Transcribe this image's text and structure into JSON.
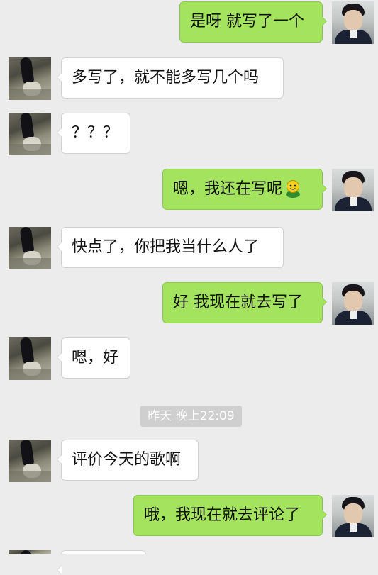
{
  "chat": {
    "messages": [
      {
        "side": "out",
        "text": "是呀 就写了一个"
      },
      {
        "side": "in",
        "text": "多写了，就不能多写几个吗"
      },
      {
        "side": "in",
        "text": "？？？"
      },
      {
        "side": "out",
        "text": "嗯，我还在写呢",
        "emoji": "smiley-emoji-icon"
      },
      {
        "side": "in",
        "text": "快点了，你把我当什么人了"
      },
      {
        "side": "out",
        "text": "好 我现在就去写了"
      },
      {
        "side": "in",
        "text": "嗯，好"
      },
      {
        "side": "in",
        "text": "评价今天的歌啊"
      },
      {
        "side": "out",
        "text": "哦，我现在就去评论了"
      }
    ],
    "timestamp": "昨天 晚上22:09"
  },
  "colors": {
    "background": "#ececec",
    "outgoing_bubble": "#a3e35d",
    "incoming_bubble": "#ffffff",
    "timestamp_pill": "#cfcfcf"
  }
}
